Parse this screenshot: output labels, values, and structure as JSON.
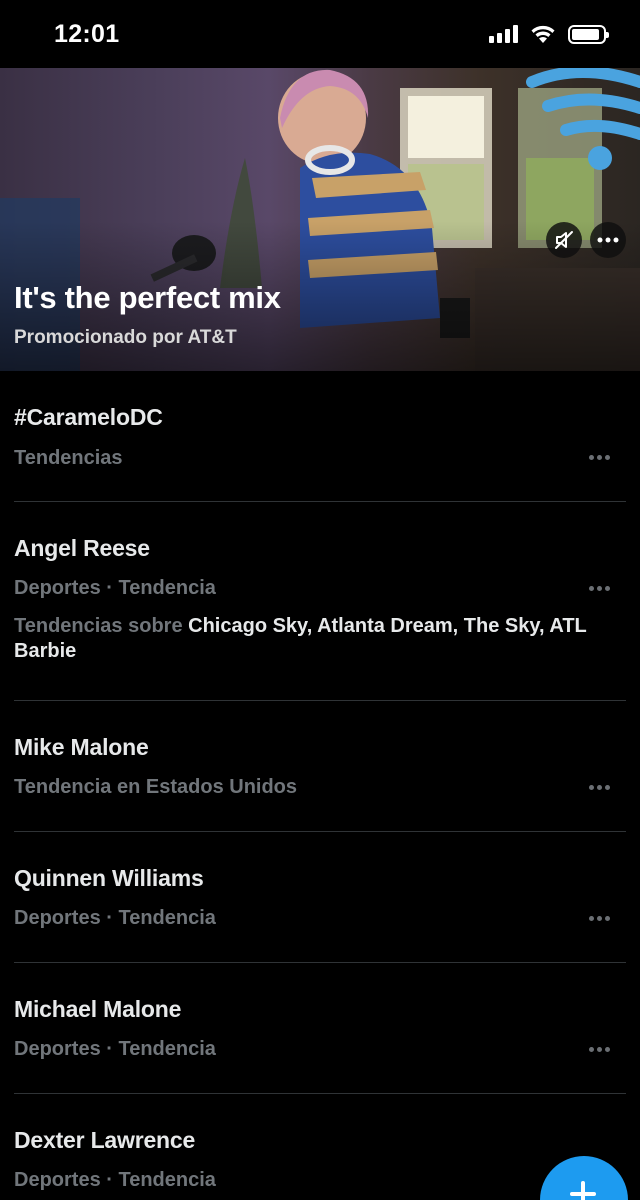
{
  "status_bar": {
    "time": "12:01",
    "battery_level": 0.9
  },
  "promo": {
    "title": "It's the perfect mix",
    "subtitle": "Promocionado por AT&T",
    "advertiser_logo_icon": "wifi-logo-icon",
    "mute_icon": "muted-speaker-icon",
    "more_icon": "more-horizontal-icon"
  },
  "trends": [
    {
      "title": "#CarameloDC",
      "meta": "Tendencias"
    },
    {
      "title": "Angel Reese",
      "meta": "Deportes · Tendencia",
      "extra_prefix": "Tendencias sobre ",
      "extra_topics": "Chicago Sky, Atlanta Dream, The Sky, ATL Barbie"
    },
    {
      "title": "Mike Malone",
      "meta": "Tendencia en Estados Unidos"
    },
    {
      "title": "Quinnen Williams",
      "meta": "Deportes · Tendencia"
    },
    {
      "title": "Michael Malone",
      "meta": "Deportes · Tendencia"
    },
    {
      "title": "Dexter Lawrence",
      "meta": "Deportes · Tendencia"
    }
  ],
  "fab": {
    "icon": "plus-icon"
  },
  "colors": {
    "accent": "#1d9bf0",
    "background": "#000000",
    "muted_text": "#71767b",
    "divider": "#2f3336"
  }
}
